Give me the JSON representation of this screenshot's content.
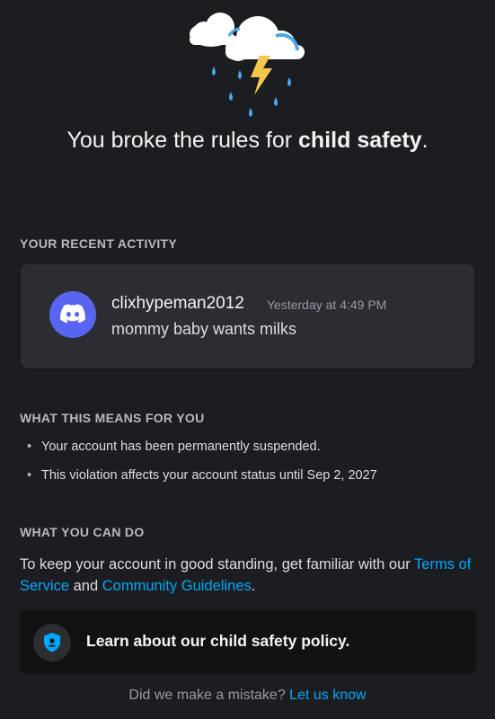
{
  "header": {
    "headline_prefix": "You broke the rules for ",
    "headline_bold": "child safety",
    "headline_suffix": ".",
    "illustration_icon": "storm-cloud-icon"
  },
  "recent_activity": {
    "label": "YOUR RECENT ACTIVITY",
    "message": {
      "avatar_icon": "discord-logo-icon",
      "username": "clixhypeman2012",
      "timestamp": "Yesterday at 4:49 PM",
      "text": "mommy baby wants milks"
    }
  },
  "what_this_means": {
    "label": "WHAT THIS MEANS FOR YOU",
    "items": [
      "Your account has been permanently suspended.",
      "This violation affects your account status until Sep 2, 2027"
    ]
  },
  "what_you_can_do": {
    "label": "WHAT YOU CAN DO",
    "text_before": "To keep your account in good standing, get familiar with our ",
    "terms_link": "Terms of Service",
    "text_between": " and ",
    "guidelines_link": "Community Guidelines",
    "text_after": "."
  },
  "policy_card": {
    "icon": "shield-icon",
    "label": "Learn about our child safety policy."
  },
  "footer": {
    "question": "Did we make a mistake?",
    "link": "Let us know"
  },
  "colors": {
    "background": "#1c1d21",
    "card": "#2b2d31",
    "accent_link": "#00a8fc",
    "blurple": "#5865f2"
  }
}
